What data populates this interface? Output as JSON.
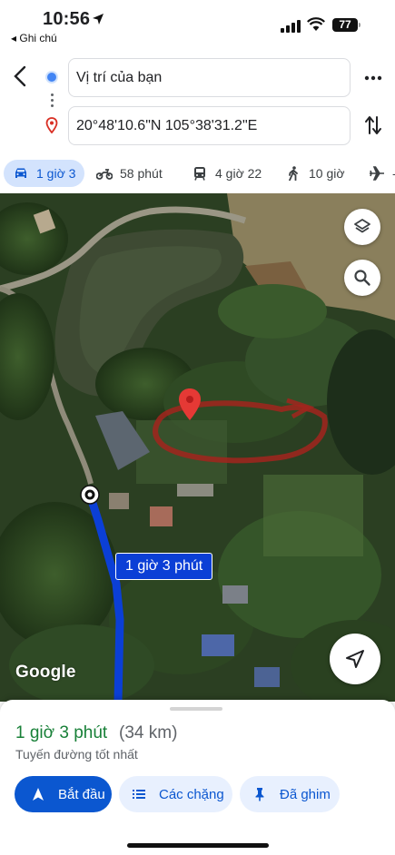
{
  "status_bar": {
    "time": "10:56",
    "back_app": "◂ Ghi chú",
    "battery": "77"
  },
  "directions": {
    "origin": "Vị trí của bạn",
    "destination": "20°48'10.6\"N 105°38'31.2\"E"
  },
  "modes": [
    {
      "icon": "car-icon",
      "label": "1 giờ 3",
      "active": true
    },
    {
      "icon": "motorbike-icon",
      "label": "58 phút"
    },
    {
      "icon": "transit-icon",
      "label": "4 giờ 22"
    },
    {
      "icon": "walk-icon",
      "label": "10 giờ"
    },
    {
      "icon": "flight-icon",
      "label": "-"
    }
  ],
  "map": {
    "route_label": "1 giờ 3 phút",
    "logo": "Google",
    "route_color": "#0b3fd6"
  },
  "sheet": {
    "duration": "1 giờ 3 phút",
    "distance": "(34 km)",
    "subtitle": "Tuyến đường tốt nhất",
    "start_label": "Bắt đầu",
    "steps_label": "Các chặng",
    "pin_label": "Đã ghim"
  },
  "colors": {
    "accent": "#0b57d0",
    "duration_green": "#188038",
    "destination_pin": "#d93025"
  }
}
